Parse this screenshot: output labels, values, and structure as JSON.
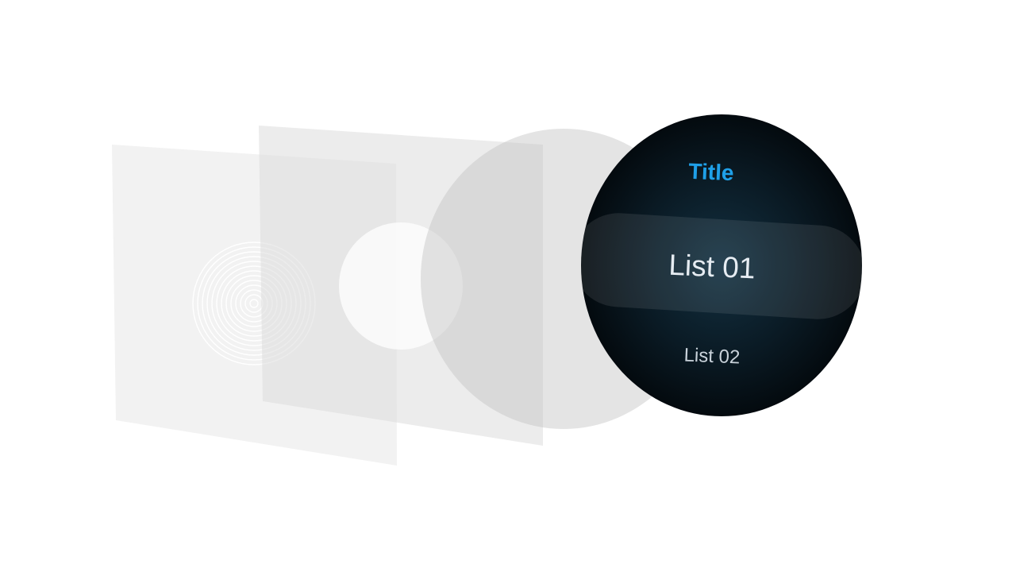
{
  "colors": {
    "title_accent": "#1fa0e8",
    "list_text": "#e6ecf2",
    "watch_face_center": "#133142",
    "watch_face_edge": "#020609"
  },
  "watch": {
    "title": "Title",
    "items": [
      {
        "label": "List 01",
        "focused": true
      },
      {
        "label": "List 02",
        "focused": false
      }
    ]
  }
}
